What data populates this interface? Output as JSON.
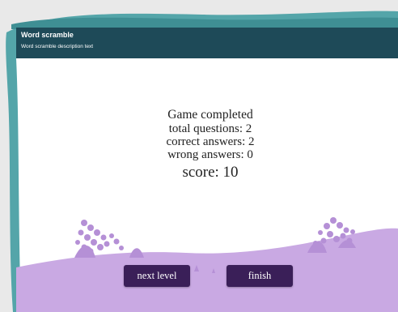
{
  "header": {
    "title": "Word scramble",
    "description": "Word scramble description text"
  },
  "result": {
    "heading": "Game completed",
    "total_questions": "total questions: 2",
    "correct_answers": "correct answers: 2",
    "wrong_answers": "wrong answers: 0",
    "score": "score: 10"
  },
  "buttons": {
    "next_level": "next level",
    "finish": "finish"
  },
  "colors": {
    "frame_teal": "#54a5a9",
    "header_bg": "#1e4a58",
    "ground": "#c9a9e3",
    "plant": "#b590d6",
    "button_bg": "#3a1f58"
  }
}
